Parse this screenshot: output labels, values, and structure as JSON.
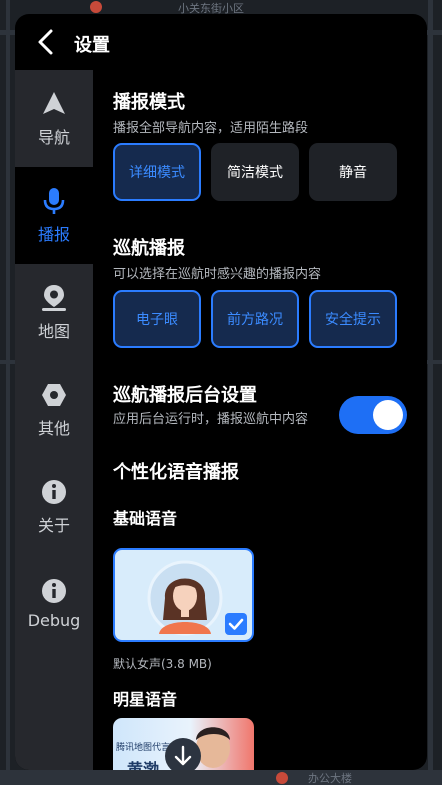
{
  "map": {
    "labels": [
      "小关东街小区",
      "办公大楼"
    ]
  },
  "header": {
    "title": "设置"
  },
  "sidebar": {
    "items": [
      {
        "label": "导航",
        "icon": "navigation-arrow-icon",
        "active": false
      },
      {
        "label": "播报",
        "icon": "microphone-icon",
        "active": true
      },
      {
        "label": "地图",
        "icon": "map-pin-icon",
        "active": false
      },
      {
        "label": "其他",
        "icon": "hexagon-dot-icon",
        "active": false
      },
      {
        "label": "关于",
        "icon": "info-icon",
        "active": false
      },
      {
        "label": "Debug",
        "icon": "info-icon",
        "active": false
      }
    ]
  },
  "broadcast_mode": {
    "title": "播报模式",
    "desc": "播报全部导航内容，适用陌生路段",
    "options": [
      {
        "label": "详细模式",
        "selected": true
      },
      {
        "label": "简洁模式",
        "selected": false
      },
      {
        "label": "静音",
        "selected": false
      }
    ]
  },
  "cruise": {
    "title": "巡航播报",
    "desc": "可以选择在巡航时感兴趣的播报内容",
    "options": [
      {
        "label": "电子眼",
        "selected": true
      },
      {
        "label": "前方路况",
        "selected": true
      },
      {
        "label": "安全提示",
        "selected": true
      }
    ]
  },
  "cruise_bg": {
    "title": "巡航播报后台设置",
    "desc": "应用后台运行时，播报巡航中内容",
    "enabled": true
  },
  "voice": {
    "title": "个性化语音播报",
    "basic_title": "基础语音",
    "basic_caption": "默认女声(3.8 MB)",
    "basic_selected": true,
    "star_title": "明星语音",
    "star_card_small": "腾讯地图代言",
    "star_card_name": "黄渤"
  },
  "colors": {
    "accent": "#2b7cff",
    "panel": "#000000",
    "sidebar": "#26282d",
    "button": "#1f2227"
  }
}
